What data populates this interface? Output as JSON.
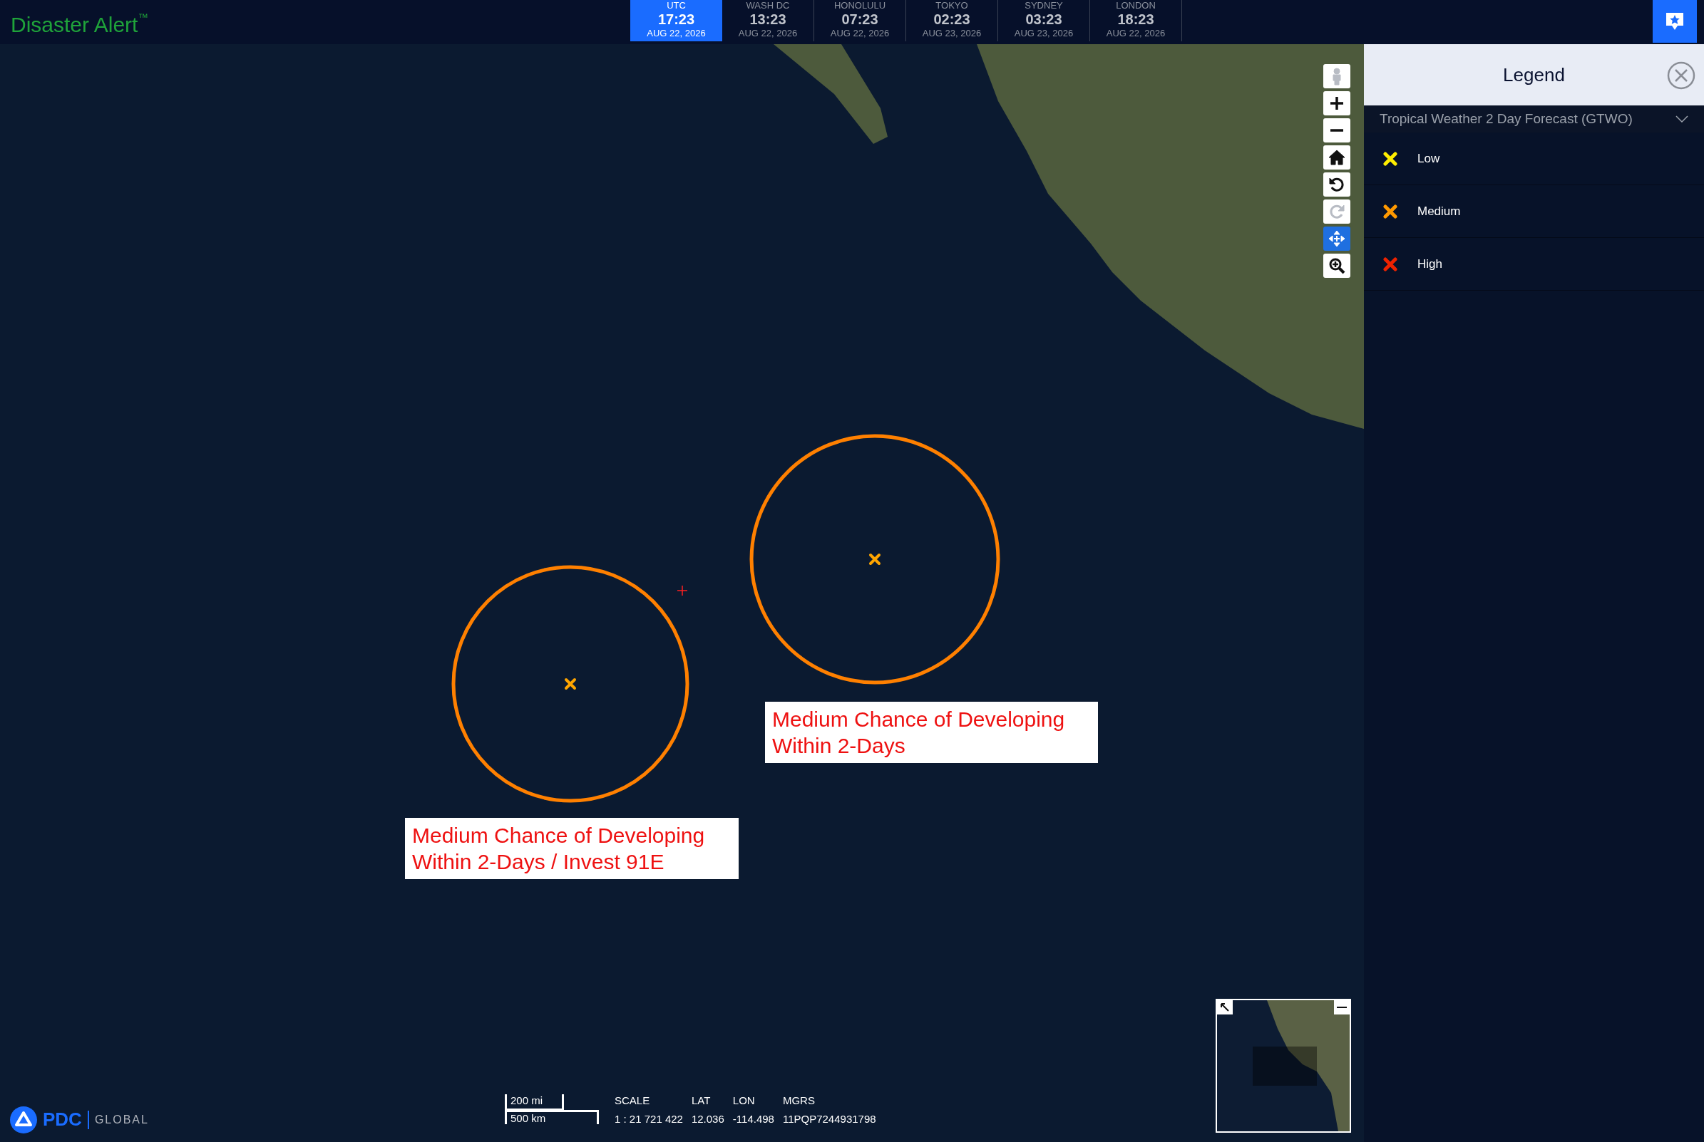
{
  "app": {
    "title": "Disaster Alert",
    "trademark": "™"
  },
  "clocks": [
    {
      "city": "UTC",
      "time": "17:23",
      "date": "AUG 22, 2026",
      "selected": true
    },
    {
      "city": "WASH DC",
      "time": "13:23",
      "date": "AUG 22, 2026",
      "selected": false
    },
    {
      "city": "HONOLULU",
      "time": "07:23",
      "date": "AUG 22, 2026",
      "selected": false
    },
    {
      "city": "TOKYO",
      "time": "02:23",
      "date": "AUG 23, 2026",
      "selected": false
    },
    {
      "city": "SYDNEY",
      "time": "03:23",
      "date": "AUG 23, 2026",
      "selected": false
    },
    {
      "city": "LONDON",
      "time": "18:23",
      "date": "AUG 22, 2026",
      "selected": false
    }
  ],
  "legend": {
    "title": "Legend",
    "section": {
      "title": "Tropical Weather 2 Day Forecast (GTWO)",
      "expanded": true
    },
    "items": [
      {
        "label": "Low",
        "color": "#ffee00"
      },
      {
        "label": "Medium",
        "color": "#ff9900"
      },
      {
        "label": "High",
        "color": "#ee2200"
      }
    ]
  },
  "map": {
    "zones": [
      {
        "label": "Medium Chance of Developing Within 2-Days / Invest 91E",
        "color": "#ff8000"
      },
      {
        "label": "Medium Chance of Developing Within 2-Days",
        "color": "#ff8000"
      }
    ],
    "controls": [
      {
        "kind": "person",
        "disabled": true
      },
      {
        "kind": "zoom-in",
        "disabled": false
      },
      {
        "kind": "zoom-out",
        "disabled": false
      },
      {
        "kind": "home",
        "disabled": false
      },
      {
        "kind": "rotate-left",
        "disabled": false
      },
      {
        "kind": "rotate-right",
        "disabled": true
      },
      {
        "kind": "pan",
        "disabled": false
      },
      {
        "kind": "zoom-box",
        "disabled": false
      }
    ]
  },
  "footer": {
    "brand": "PDC",
    "brand_sub": "GLOBAL",
    "scale_bar": [
      "200 mi",
      "500 km"
    ],
    "readout": [
      {
        "label": "SCALE",
        "value": "1 : 21 721 422"
      },
      {
        "label": "LAT",
        "value": "12.036"
      },
      {
        "label": "LON",
        "value": "-114.498"
      },
      {
        "label": "MGRS",
        "value": "11PQP7244931798"
      }
    ]
  }
}
